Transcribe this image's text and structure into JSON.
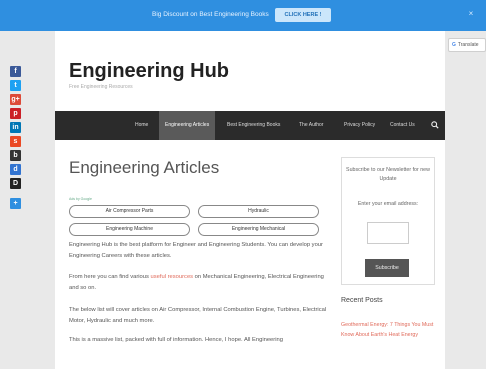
{
  "promo": {
    "text": "Big Discount on Best Engineering Books",
    "button": "CLICK HERE !",
    "close": "×"
  },
  "translate": {
    "g": "G",
    "label": "Translate"
  },
  "social": [
    {
      "name": "facebook-icon",
      "glyph": "f",
      "color": "#3b5998"
    },
    {
      "name": "twitter-icon",
      "glyph": "t",
      "color": "#1da1f2"
    },
    {
      "name": "google-plus-icon",
      "glyph": "g+",
      "color": "#dd4b39"
    },
    {
      "name": "pinterest-icon",
      "glyph": "p",
      "color": "#cb2027"
    },
    {
      "name": "linkedin-icon",
      "glyph": "in",
      "color": "#0077b5"
    },
    {
      "name": "stumbleupon-icon",
      "glyph": "s",
      "color": "#eb4924"
    },
    {
      "name": "buffer-icon",
      "glyph": "b",
      "color": "#333333"
    },
    {
      "name": "delicious-icon",
      "glyph": "d",
      "color": "#3274d1"
    },
    {
      "name": "digg-icon",
      "glyph": "D",
      "color": "#222222"
    },
    {
      "name": "more-share-icon",
      "glyph": "+",
      "color": "#2f8fe0"
    }
  ],
  "site": {
    "title": "Engineering Hub",
    "description": "Free Engineering Resources"
  },
  "nav": {
    "items": [
      "Home",
      "Engineering Articles",
      "Best Engineering Books",
      "The Author",
      "Privacy Policy",
      "Contact Us"
    ],
    "active_index": 1
  },
  "main": {
    "title": "Engineering Articles",
    "search_credit": "Ads by Google",
    "pills": [
      "Air Compressor Parts",
      "Hydraulic",
      "Engineering Machine",
      "Engineering Mechanical"
    ],
    "para1": "Engineering Hub is the best platform for Engineer and Engineering Students. You can develop your Engineering Careers with these articles.",
    "para2_before": "From here you can find various ",
    "para2_link": "useful resources",
    "para2_after": " on Mechanical Engineering, Electrical Engineering and so on.",
    "para3": "The below list will cover articles on Air Compressor, Internal Combustion Engine, Turbines, Electrical Motor, Hydraulic and much more.",
    "para4": "This is a massive list, packed with full of information. Hence, I hope. All Engineering"
  },
  "sidebar": {
    "newsletter_title": "Subscribe to our Newsletter for new Update",
    "email_label": "Enter your email address:",
    "subscribe_button": "Subscribe",
    "recent_title": "Recent Posts",
    "recent_posts": [
      "Geothermal Energy: 7 Things You Must Know About Earth's Heat Energy"
    ]
  }
}
